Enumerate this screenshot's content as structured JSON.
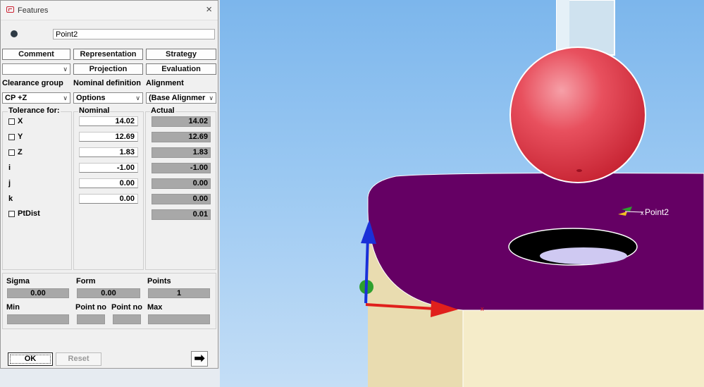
{
  "window": {
    "title": "Features",
    "close_icon": "×"
  },
  "feature_name": "Point2",
  "buttons": {
    "comment": "Comment",
    "representation": "Representation",
    "strategy": "Strategy",
    "projection": "Projection",
    "evaluation": "Evaluation",
    "ok": "OK",
    "reset": "Reset",
    "next_arrow": "➡"
  },
  "labels": {
    "clearance_group": "Clearance group",
    "nominal_definition": "Nominal definition",
    "alignment": "Alignment",
    "tolerance_for": "Tolerance for:",
    "nominal": "Nominal",
    "actual": "Actual"
  },
  "combos": {
    "blank": "",
    "clearance": "CP +Z",
    "nominal_def": "Options",
    "alignment": "(Base Alignmer"
  },
  "rows": [
    {
      "label": "X",
      "checkbox": true,
      "nominal": "14.02",
      "actual": "14.02"
    },
    {
      "label": "Y",
      "checkbox": true,
      "nominal": "12.69",
      "actual": "12.69"
    },
    {
      "label": "Z",
      "checkbox": true,
      "nominal": "1.83",
      "actual": "1.83"
    },
    {
      "label": "i",
      "checkbox": false,
      "nominal": "-1.00",
      "actual": "-1.00"
    },
    {
      "label": "j",
      "checkbox": false,
      "nominal": "0.00",
      "actual": "0.00"
    },
    {
      "label": "k",
      "checkbox": false,
      "nominal": "0.00",
      "actual": "0.00"
    },
    {
      "label": "PtDist",
      "checkbox": true,
      "nominal": "",
      "actual": "0.01"
    }
  ],
  "stats": {
    "sigma_label": "Sigma",
    "sigma": "0.00",
    "form_label": "Form",
    "form": "0.00",
    "points_label": "Points",
    "points": "1",
    "min_label": "Min",
    "point_no_label_1": "Point no",
    "point_no_label_2": "Point no",
    "max_label": "Max"
  },
  "viewport": {
    "point_label": "Point2",
    "face_color": "#650064",
    "side_color": "#f5ecc9",
    "probe_color": "#e83a4c"
  }
}
